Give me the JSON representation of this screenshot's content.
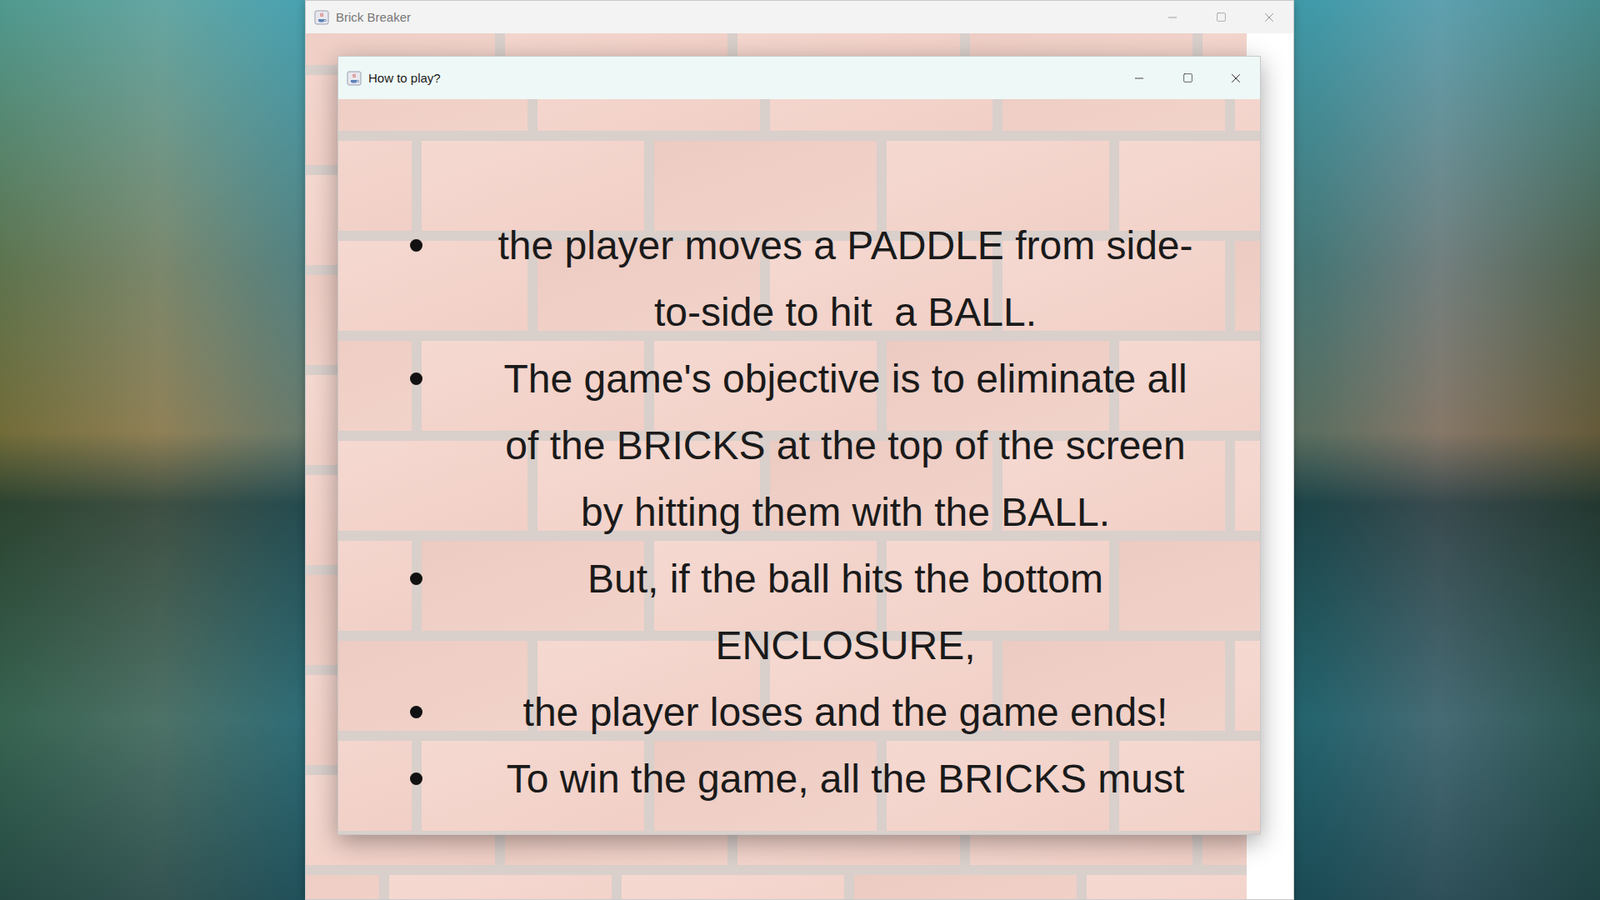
{
  "main_window": {
    "title": "Brick Breaker",
    "active": false
  },
  "dialog": {
    "title": "How to play?",
    "active": true,
    "items": [
      {
        "text": "the player moves a PADDLE from side-to-side to hit  a BALL."
      },
      {
        "text": "The game's objective is to eliminate all of the BRICKS at the top of the screen by hitting them with the BALL."
      },
      {
        "text": "But, if the ball hits the bottom ENCLOSURE,"
      },
      {
        "text": "the player loses and the game ends!"
      },
      {
        "text": "To win the game, all the BRICKS must"
      }
    ]
  }
}
